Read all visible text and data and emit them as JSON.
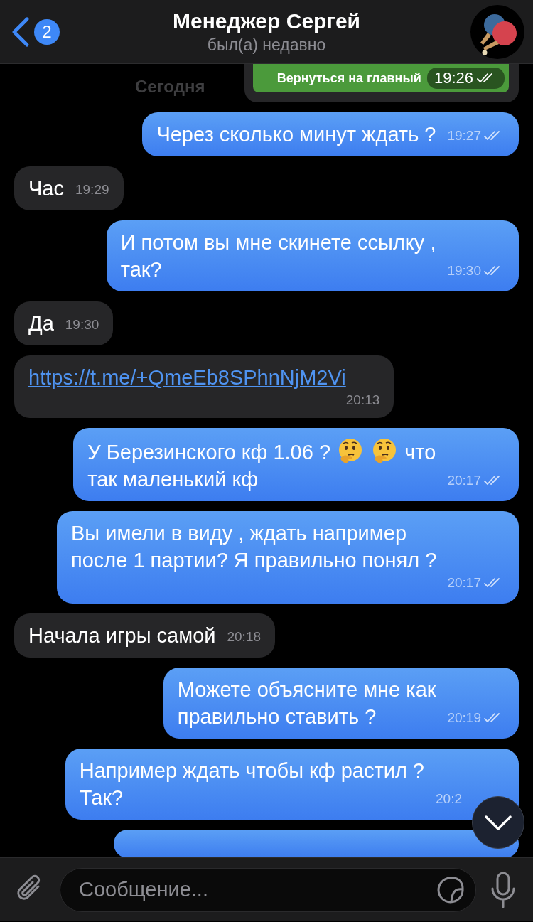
{
  "header": {
    "back_badge": "2",
    "title": "Менеджер Сергей",
    "status": "был(а) недавно"
  },
  "date_pill": "Сегодня",
  "messages": [
    {
      "outgoing": false,
      "kind": "button",
      "button": "Вернуться на главный",
      "time": "19:26",
      "read": true
    },
    {
      "outgoing": true,
      "kind": "text",
      "text": "Через сколько минут ждать ?",
      "time": "19:27",
      "read": true
    },
    {
      "outgoing": false,
      "kind": "text",
      "text": "Час",
      "time": "19:29"
    },
    {
      "outgoing": true,
      "kind": "text",
      "text": "И потом вы мне скинете ссылку ,\nтак?",
      "time": "19:30",
      "read": true
    },
    {
      "outgoing": false,
      "kind": "text",
      "text": "Да",
      "time": "19:30"
    },
    {
      "outgoing": false,
      "kind": "link",
      "text": "https://t.me/+QmeEb8SPhnNjM2Vi",
      "time": "20:13"
    },
    {
      "outgoing": true,
      "kind": "lines",
      "lines": [
        [
          {
            "kind": "text",
            "text": "У Березинского кф 1.06 ?"
          },
          {
            "kind": "emoji"
          },
          {
            "kind": "emoji"
          },
          {
            "kind": "text",
            "text": "что"
          }
        ],
        [
          {
            "kind": "text",
            "text": "так маленький кф"
          }
        ]
      ],
      "time": "20:17",
      "read": true
    },
    {
      "outgoing": true,
      "kind": "text",
      "text": "Вы имели в виду , ждать например\nпосле 1 партии? Я правильно понял ?",
      "time": "20:17",
      "read": true
    },
    {
      "outgoing": false,
      "kind": "text",
      "text": "Начала игры самой",
      "time": "20:18"
    },
    {
      "outgoing": true,
      "kind": "text",
      "text": "Можете объясните мне как\nправильно ставить ?",
      "time": "20:19",
      "read": true
    },
    {
      "outgoing": true,
      "kind": "text",
      "text": "Например ждать чтобы кф растил ?\nТак?",
      "time": "20:2"
    },
    {
      "outgoing": true,
      "kind": "empty"
    }
  ],
  "composer": {
    "placeholder": "Сообщение..."
  }
}
